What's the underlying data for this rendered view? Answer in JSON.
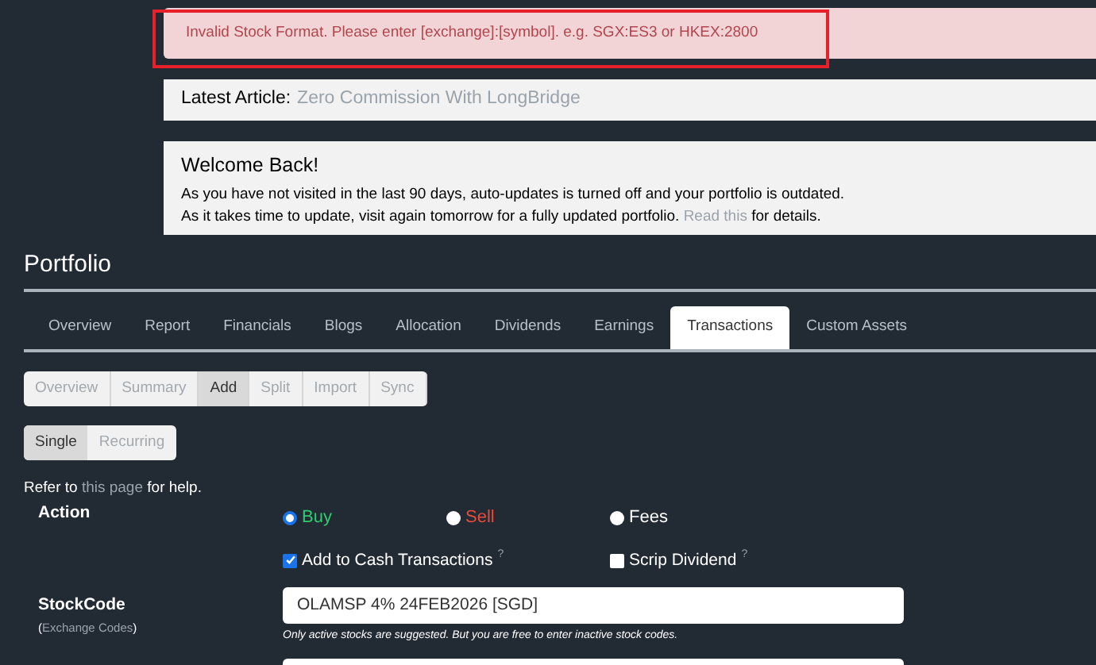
{
  "alert": {
    "text": "Invalid Stock Format. Please enter [exchange]:[symbol]. e.g. SGX:ES3 or HKEX:2800"
  },
  "latest_article": {
    "label": "Latest Article:",
    "title": "Zero Commission With LongBridge"
  },
  "welcome": {
    "title": "Welcome Back!",
    "line1": "As you have not visited in the last 90 days, auto-updates is turned off and your portfolio is outdated.",
    "line2": "As it takes time to update, visit again tomorrow for a fully updated portfolio.",
    "link": "Read this",
    "line2_end": "for details."
  },
  "page_title": "Portfolio",
  "tabs": [
    {
      "label": "Overview",
      "selected": false
    },
    {
      "label": "Report",
      "selected": false
    },
    {
      "label": "Financials",
      "selected": false
    },
    {
      "label": "Blogs",
      "selected": false
    },
    {
      "label": "Allocation",
      "selected": false
    },
    {
      "label": "Dividends",
      "selected": false
    },
    {
      "label": "Earnings",
      "selected": false
    },
    {
      "label": "Transactions",
      "selected": true
    },
    {
      "label": "Custom Assets",
      "selected": false
    }
  ],
  "sub_tabs": [
    {
      "label": "Overview",
      "selected": false
    },
    {
      "label": "Summary",
      "selected": false
    },
    {
      "label": "Add",
      "selected": true
    },
    {
      "label": "Split",
      "selected": false
    },
    {
      "label": "Import",
      "selected": false
    },
    {
      "label": "Sync",
      "selected": false
    }
  ],
  "mode_tabs": [
    {
      "label": "Single",
      "selected": true
    },
    {
      "label": "Recurring",
      "selected": false
    }
  ],
  "help": {
    "before": "Refer to",
    "link": "this page",
    "after": "for help."
  },
  "form": {
    "action_label": "Action",
    "actions": [
      {
        "label": "Buy",
        "selected": true,
        "color": "#2ecc71"
      },
      {
        "label": "Sell",
        "selected": false,
        "color": "#e74c3c"
      },
      {
        "label": "Fees",
        "selected": false,
        "color": "#ffffff"
      }
    ],
    "options": [
      {
        "label": "Add to Cash Transactions",
        "mark": "?",
        "checked": true
      },
      {
        "label": "Scrip Dividend",
        "mark": "?",
        "checked": false
      }
    ],
    "stock_label": "StockCode",
    "stock_link_before": "(",
    "stock_link": "Exchange Codes",
    "stock_link_after": ")",
    "stock_value": "OLAMSP 4% 24FEB2026 [SGD]",
    "stock_hint": "Only active stocks are suggested. But you are free to enter inactive stock codes."
  }
}
